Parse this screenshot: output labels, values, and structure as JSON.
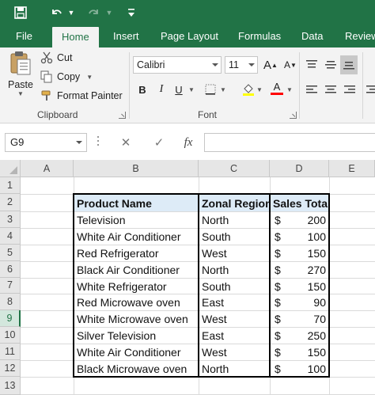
{
  "quick_access": {
    "save_icon": "save-icon",
    "undo_icon": "undo-icon",
    "redo_icon": "redo-icon",
    "customize_icon": "customize-qat-icon"
  },
  "tabs": [
    {
      "label": "File"
    },
    {
      "label": "Home"
    },
    {
      "label": "Insert"
    },
    {
      "label": "Page Layout"
    },
    {
      "label": "Formulas"
    },
    {
      "label": "Data"
    },
    {
      "label": "Review"
    }
  ],
  "ribbon": {
    "clipboard": {
      "paste_label": "Paste",
      "cut_label": "Cut",
      "copy_label": "Copy",
      "format_painter_label": "Format Painter",
      "group_label": "Clipboard"
    },
    "font": {
      "font_name": "Calibri",
      "font_size": "11",
      "bold": "B",
      "italic": "I",
      "underline": "U",
      "grow_font": "A",
      "shrink_font": "A",
      "font_color_glyph": "A",
      "font_color": "#ff0000",
      "group_label": "Font"
    }
  },
  "formula_bar": {
    "name_box": "G9",
    "cancel": "✕",
    "enter": "✓",
    "fx": "fx",
    "value": ""
  },
  "columns": [
    "A",
    "B",
    "C",
    "D",
    "E"
  ],
  "rows": [
    "1",
    "2",
    "3",
    "4",
    "5",
    "6",
    "7",
    "8",
    "9",
    "10",
    "11",
    "12",
    "13"
  ],
  "selected_row": "9",
  "table": {
    "headers": [
      "Product Name",
      "Zonal Region",
      "Sales Total"
    ],
    "currency_symbol": "$",
    "header_fill": "#ddebf7",
    "rows": [
      {
        "product": "Television",
        "region": "North",
        "sales": "200"
      },
      {
        "product": "White Air Conditioner",
        "region": "South",
        "sales": "100"
      },
      {
        "product": "Red Refrigerator",
        "region": "West",
        "sales": "150"
      },
      {
        "product": "Black Air Conditioner",
        "region": "North",
        "sales": "270"
      },
      {
        "product": "White Refrigerator",
        "region": "South",
        "sales": "150"
      },
      {
        "product": "Red Microwave oven",
        "region": "East",
        "sales": "90"
      },
      {
        "product": "White Microwave oven",
        "region": "West",
        "sales": "70"
      },
      {
        "product": "Silver Television",
        "region": "East",
        "sales": "250"
      },
      {
        "product": "White Air Conditioner",
        "region": "West",
        "sales": "150"
      },
      {
        "product": "Black Microwave oven",
        "region": "North",
        "sales": "100"
      }
    ]
  },
  "colors": {
    "accent": "#217346",
    "ribbon_bg": "#f3f3f3"
  }
}
